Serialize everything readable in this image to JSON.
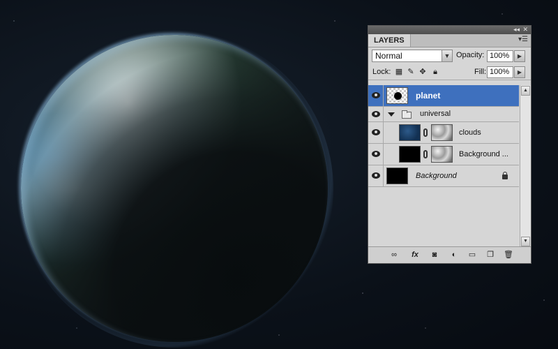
{
  "panel": {
    "tab_label": "LAYERS",
    "blend_mode": "Normal",
    "opacity_label": "Opacity:",
    "opacity_value": "100%",
    "lock_label": "Lock:",
    "fill_label": "Fill:",
    "fill_value": "100%"
  },
  "layers": [
    {
      "name": "planet",
      "selected": true,
      "thumb": "checker-with-circle"
    },
    {
      "name": "universal",
      "type": "group",
      "expanded": true
    },
    {
      "name": "clouds",
      "thumb": "blue",
      "mask": true,
      "indent": true
    },
    {
      "name": "Background ...",
      "thumb": "black",
      "mask": true,
      "indent": true
    },
    {
      "name": "Background",
      "thumb": "black",
      "italic": true,
      "locked": true
    }
  ],
  "bottom_icons": {
    "fx_label": "fx"
  },
  "colors": {
    "selected_row": "#3e70be",
    "panel_bg": "#d6d6d6"
  }
}
